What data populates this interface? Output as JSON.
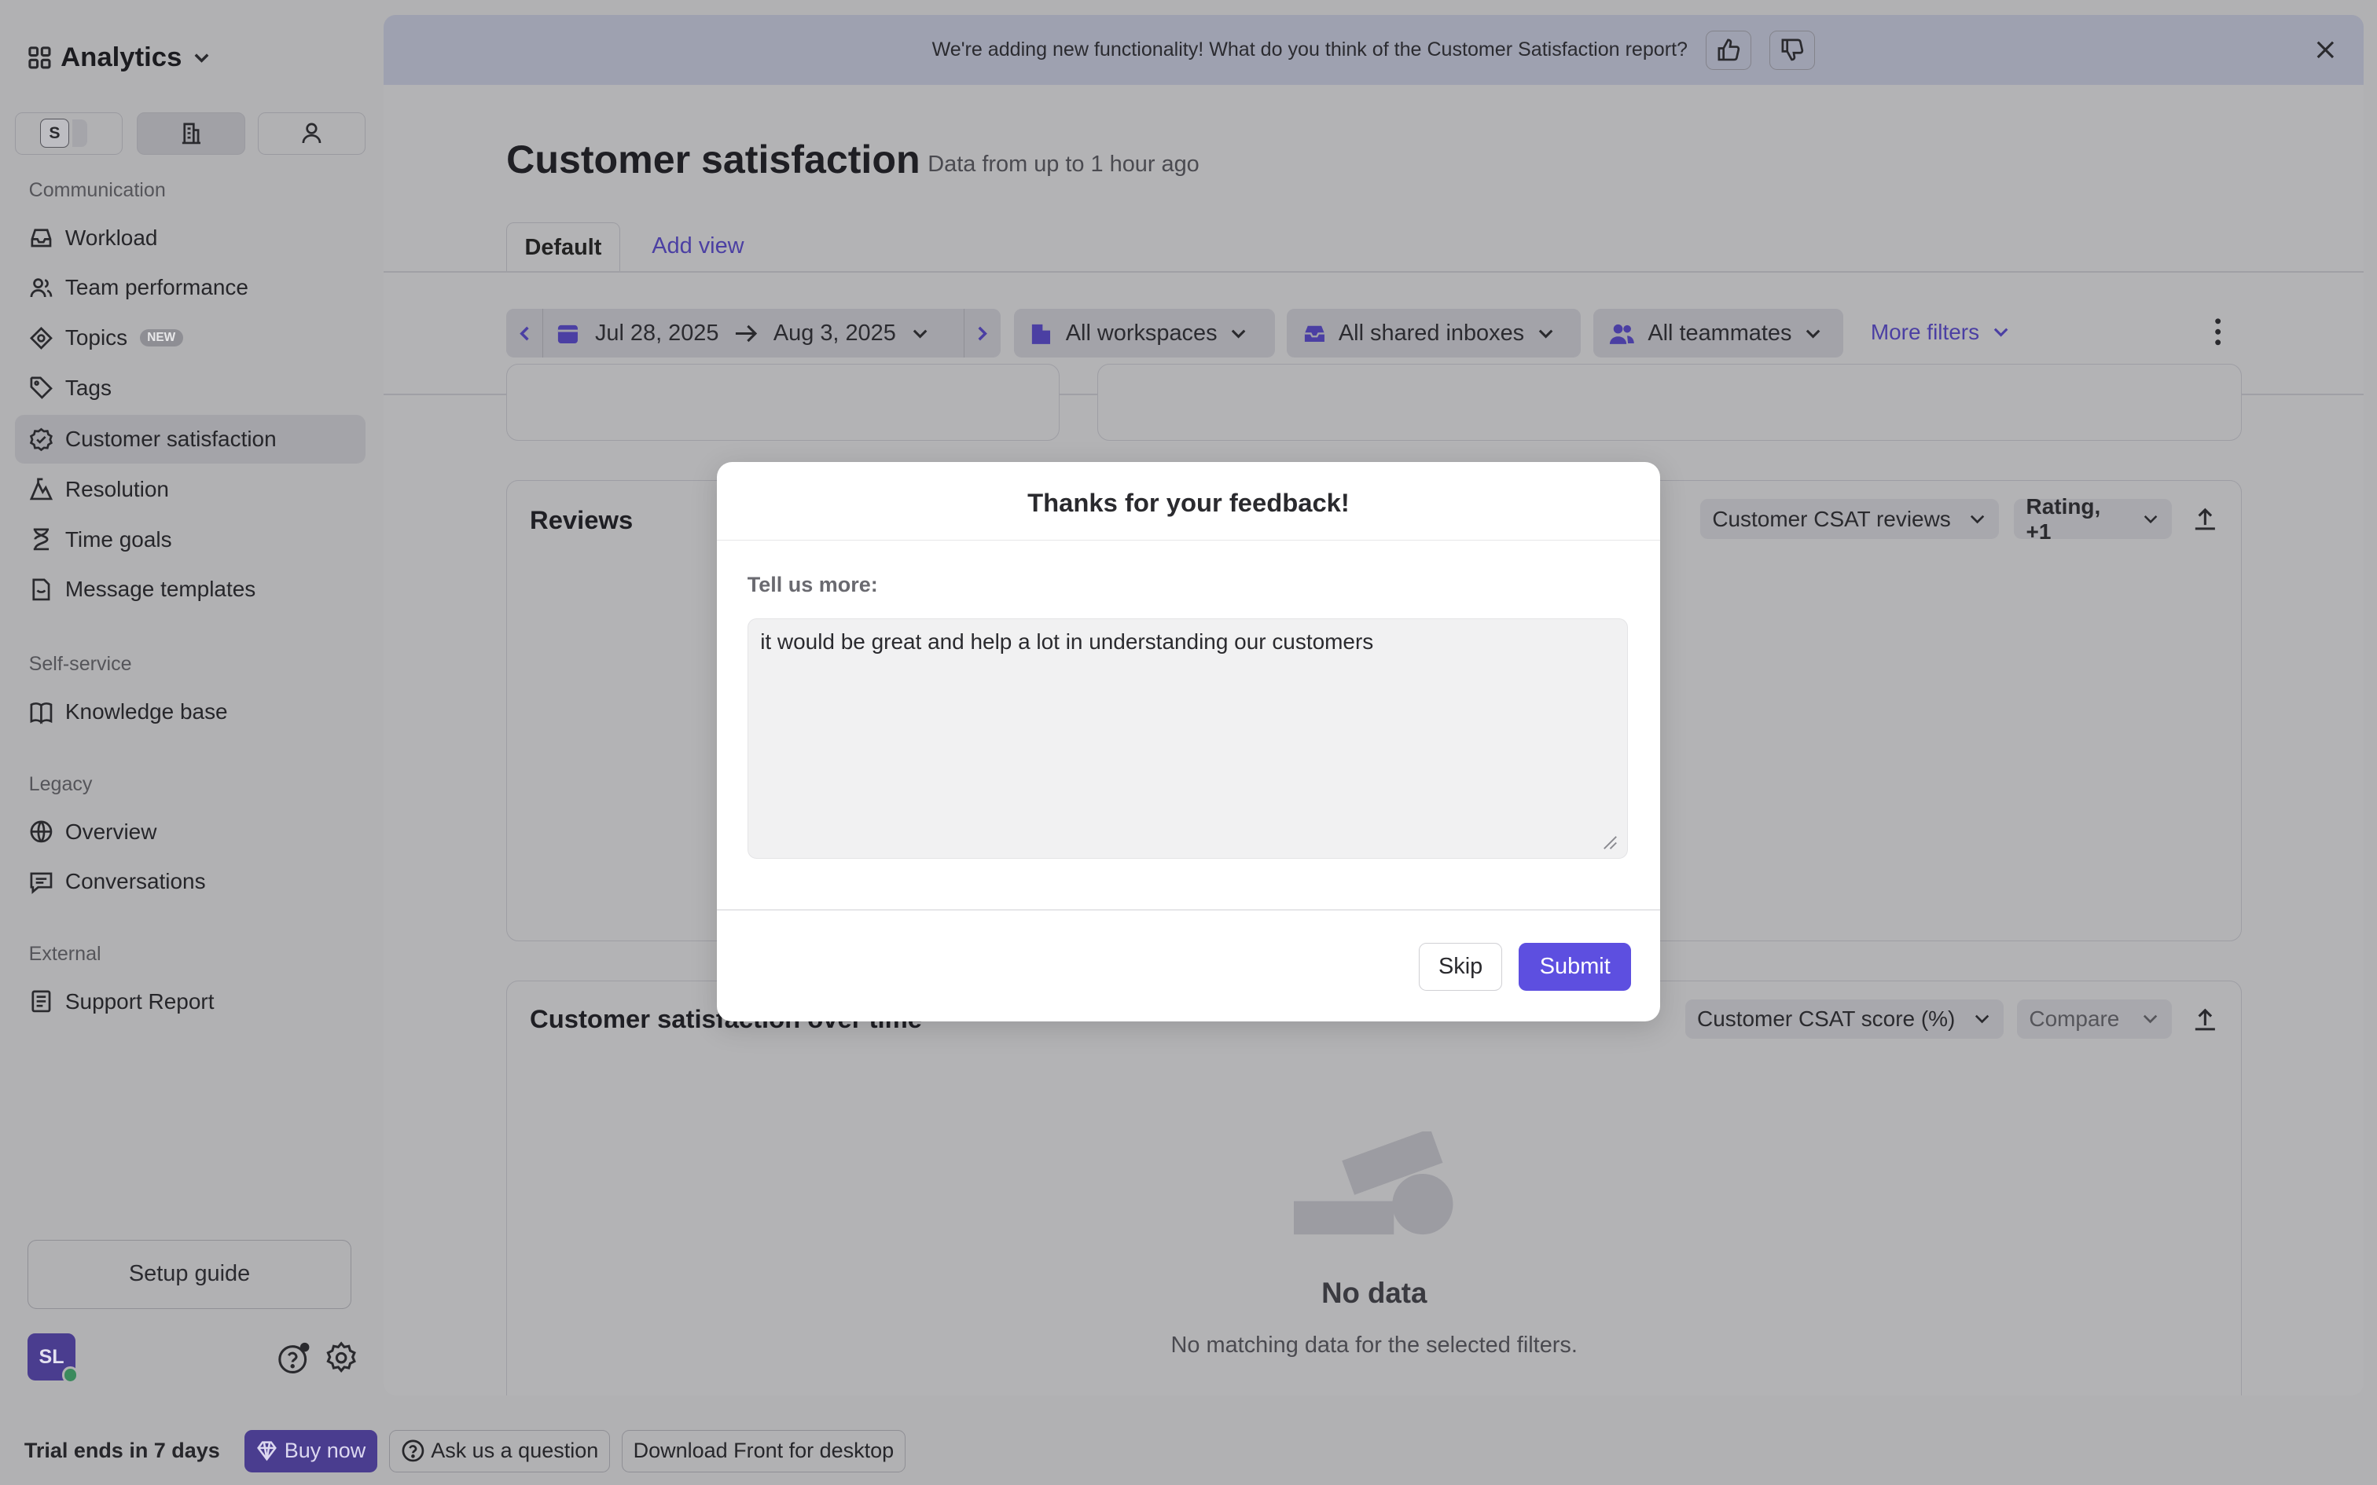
{
  "sidebar": {
    "app_title": "Analytics",
    "switch_badge": "S",
    "sections": {
      "communication": "Communication",
      "self_service": "Self-service",
      "legacy": "Legacy",
      "external": "External"
    },
    "items": [
      {
        "label": "Workload"
      },
      {
        "label": "Team performance"
      },
      {
        "label": "Topics",
        "badge": "NEW"
      },
      {
        "label": "Tags"
      },
      {
        "label": "Customer satisfaction",
        "active": true
      },
      {
        "label": "Resolution"
      },
      {
        "label": "Time goals"
      },
      {
        "label": "Message templates"
      },
      {
        "label": "Knowledge base"
      },
      {
        "label": "Overview"
      },
      {
        "label": "Conversations"
      },
      {
        "label": "Support Report"
      }
    ],
    "setup_guide": "Setup guide",
    "avatar_initials": "SL"
  },
  "bottom_bar": {
    "trial": "Trial ends in 7 days",
    "buy_now": "Buy now",
    "ask": "Ask us a question",
    "download": "Download Front for desktop"
  },
  "banner": {
    "text": "We're adding new functionality! What do you think of the Customer Satisfaction report?"
  },
  "header": {
    "title": "Customer satisfaction",
    "subtitle": "Data from up to 1 hour ago",
    "tabs": [
      {
        "label": "Default",
        "active": true
      },
      {
        "label": "Add view"
      }
    ]
  },
  "filters": {
    "date_start": "Jul 28, 2025",
    "date_end": "Aug 3, 2025",
    "workspaces": "All workspaces",
    "inboxes": "All shared inboxes",
    "teammates": "All teammates",
    "more": "More filters"
  },
  "reviews_card": {
    "title": "Reviews",
    "select_1": "Customer CSAT reviews",
    "select_2": "Rating, +1"
  },
  "overtime_card": {
    "title": "Customer satisfaction over time",
    "select_1": "Customer CSAT score (%)",
    "select_2": "Compare",
    "nodata_title": "No data",
    "nodata_sub": "No matching data for the selected filters."
  },
  "modal": {
    "title": "Thanks for your feedback!",
    "label": "Tell us more:",
    "textarea_value": "it would be great and help a lot in understanding our customers",
    "skip": "Skip",
    "submit": "Submit"
  },
  "colors": {
    "accent": "#5d4fe0",
    "link": "#4b3fa3",
    "overlay_bg": "#b1b1b3"
  }
}
